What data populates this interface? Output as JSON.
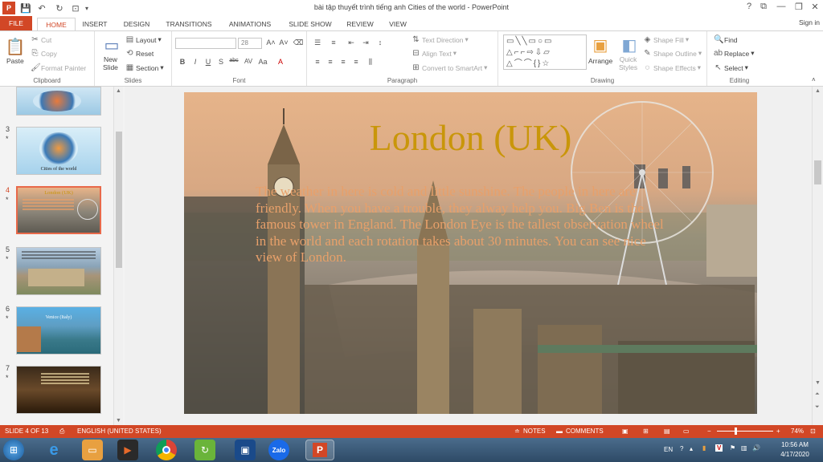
{
  "window": {
    "title": "bài tập thuyết trình tiếng anh Cities of the world - PowerPoint",
    "controls": [
      "?",
      "⧉",
      "—",
      "❐",
      "✕"
    ]
  },
  "tabs": [
    {
      "label": "FILE"
    },
    {
      "label": "HOME"
    },
    {
      "label": "INSERT"
    },
    {
      "label": "DESIGN"
    },
    {
      "label": "TRANSITIONS"
    },
    {
      "label": "ANIMATIONS"
    },
    {
      "label": "SLIDE SHOW"
    },
    {
      "label": "REVIEW"
    },
    {
      "label": "VIEW"
    }
  ],
  "signin": "Sign in",
  "ribbon": {
    "clipboard": {
      "paste": "Paste",
      "cut": "Cut",
      "copy": "Copy",
      "format_painter": "Format Painter",
      "label": "Clipboard"
    },
    "slides": {
      "new_slide": "New",
      "new_slide2": "Slide",
      "layout": "Layout",
      "reset": "Reset",
      "section": "Section",
      "label": "Slides"
    },
    "font": {
      "size": "28",
      "label": "Font"
    },
    "paragraph": {
      "text_direction": "Text Direction",
      "align_text": "Align Text",
      "smartart": "Convert to SmartArt",
      "label": "Paragraph"
    },
    "drawing": {
      "arrange": "Arrange",
      "quick_styles": "Quick",
      "quick_styles2": "Styles",
      "shape_fill": "Shape Fill",
      "shape_outline": "Shape Outline",
      "shape_effects": "Shape Effects",
      "label": "Drawing"
    },
    "editing": {
      "find": "Find",
      "replace": "Replace",
      "select": "Select",
      "label": "Editing"
    }
  },
  "thumbnails": [
    {
      "num": "3",
      "title": "Cities of the world"
    },
    {
      "num": "4",
      "title": "London (UK)"
    },
    {
      "num": "5",
      "title": ""
    },
    {
      "num": "6",
      "title": "Venice (Italy)"
    },
    {
      "num": "7",
      "title": ""
    }
  ],
  "slide": {
    "title": "London (UK)",
    "body": "The weather in here is cold and little sunshine. The people in here are friendly. When you have a trouble, they alway help you. Big Ben is the famous tower in England. The London Eye is the tallest observation wheel in the world and each rotation takes about 30 minutes. You can see nice view of London.",
    "title_color": "#c9960a",
    "body_color": "#e8a06a"
  },
  "status": {
    "slide_count": "SLIDE 4 OF 13",
    "language": "ENGLISH (UNITED STATES)",
    "notes": "NOTES",
    "comments": "COMMENTS",
    "zoom": "74%"
  },
  "tray": {
    "lang": "EN",
    "time": "10:56 AM",
    "date": "4/17/2020"
  },
  "colors": {
    "accent": "#d24726"
  }
}
